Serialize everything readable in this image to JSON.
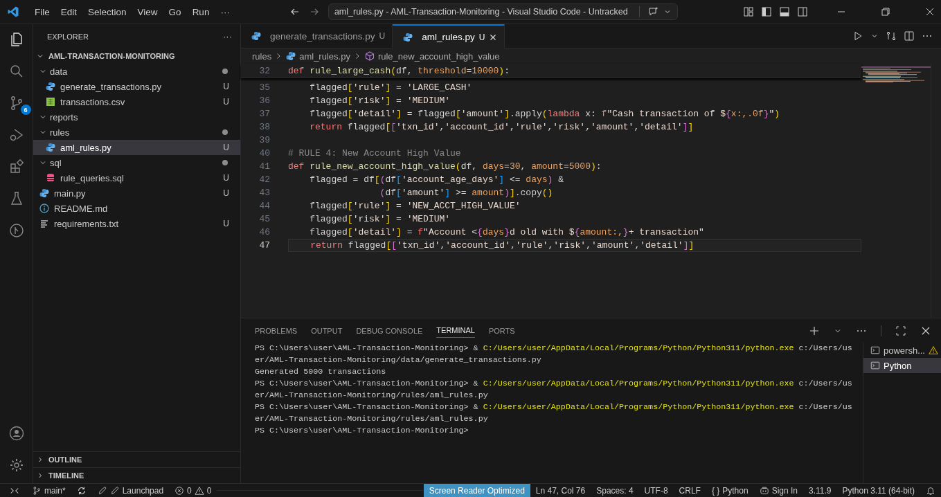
{
  "menu": [
    "File",
    "Edit",
    "Selection",
    "View",
    "Go",
    "Run",
    "···"
  ],
  "command_center": "aml_rules.py - AML-Transaction-Monitoring - Visual Studio Code - Untracked",
  "activity_badge": "6",
  "explorer": {
    "title": "EXPLORER",
    "more": "···",
    "root": {
      "label": "AML-TRANSACTION-MONITORING",
      "expanded": true,
      "children": [
        {
          "label": "data",
          "kind": "folder",
          "expanded": true,
          "dot": true,
          "selected": false,
          "children": [
            {
              "label": "generate_transactions.py",
              "kind": "python",
              "badge": "U",
              "selected": false
            },
            {
              "label": "transactions.csv",
              "kind": "csv",
              "badge": "U",
              "selected": false
            }
          ]
        },
        {
          "label": "reports",
          "kind": "folder",
          "expanded": true,
          "dot": false,
          "selected": false
        },
        {
          "label": "rules",
          "kind": "folder",
          "expanded": true,
          "dot": true,
          "selected": false,
          "children": [
            {
              "label": "aml_rules.py",
              "kind": "python",
              "badge": "U",
              "selected": true
            }
          ]
        },
        {
          "label": "sql",
          "kind": "folder",
          "expanded": true,
          "dot": true,
          "selected": false,
          "children": [
            {
              "label": "rule_queries.sql",
              "kind": "sql",
              "badge": "U",
              "selected": false
            }
          ]
        },
        {
          "label": "main.py",
          "kind": "python",
          "badge": "U",
          "selected": false
        },
        {
          "label": "README.md",
          "kind": "info",
          "selected": false
        },
        {
          "label": "requirements.txt",
          "kind": "text",
          "badge": "U",
          "selected": false
        }
      ]
    },
    "sections": [
      {
        "label": "OUTLINE",
        "expanded": false
      },
      {
        "label": "TIMELINE",
        "expanded": false
      }
    ]
  },
  "tabs": [
    {
      "label": "generate_transactions.py",
      "badge": "U",
      "selected": false
    },
    {
      "label": "aml_rules.py",
      "badge": "U",
      "selected": true
    }
  ],
  "breadcrumb": [
    "rules",
    "aml_rules.py",
    "rule_new_account_high_value"
  ],
  "sticky_line": {
    "num": "32",
    "tokens": [
      {
        "text": "def",
        "kind": "k"
      },
      {
        "text": " rule_large_cash",
        "kind": "f"
      },
      {
        "text": "(",
        "kind": "b1"
      },
      {
        "text": "df, ",
        "kind": "v"
      },
      {
        "text": "threshold",
        "kind": "p"
      },
      {
        "text": "=",
        "kind": "v"
      },
      {
        "text": "10000",
        "kind": "n"
      },
      {
        "text": ")",
        "kind": "b1"
      },
      {
        "text": ":",
        "kind": "v"
      }
    ]
  },
  "code": [
    {
      "num": "35",
      "current": false,
      "tokens": [
        {
          "text": "    flagged",
          "kind": "v"
        },
        {
          "text": "[",
          "kind": "b1"
        },
        {
          "text": "'rule'",
          "kind": "s"
        },
        {
          "text": "]",
          "kind": "b1"
        },
        {
          "text": " = ",
          "kind": "v"
        },
        {
          "text": "'LARGE_CASH'",
          "kind": "s"
        }
      ]
    },
    {
      "num": "36",
      "current": false,
      "tokens": [
        {
          "text": "    flagged",
          "kind": "v"
        },
        {
          "text": "[",
          "kind": "b1"
        },
        {
          "text": "'risk'",
          "kind": "s"
        },
        {
          "text": "]",
          "kind": "b1"
        },
        {
          "text": " = ",
          "kind": "v"
        },
        {
          "text": "'MEDIUM'",
          "kind": "s"
        }
      ]
    },
    {
      "num": "37",
      "current": false,
      "tokens": [
        {
          "text": "    flagged",
          "kind": "v"
        },
        {
          "text": "[",
          "kind": "b1"
        },
        {
          "text": "'detail'",
          "kind": "s"
        },
        {
          "text": "]",
          "kind": "b1"
        },
        {
          "text": " = flagged",
          "kind": "v"
        },
        {
          "text": "[",
          "kind": "b1"
        },
        {
          "text": "'amount'",
          "kind": "s"
        },
        {
          "text": "]",
          "kind": "b1"
        },
        {
          "text": ".apply",
          "kind": "v"
        },
        {
          "text": "(",
          "kind": "b1"
        },
        {
          "text": "lambda",
          "kind": "k"
        },
        {
          "text": " x: ",
          "kind": "v"
        },
        {
          "text": "f",
          "kind": "k"
        },
        {
          "text": "\"Cash transaction of $",
          "kind": "s"
        },
        {
          "text": "{",
          "kind": "b2"
        },
        {
          "text": "x:,.0f",
          "kind": "p"
        },
        {
          "text": "}",
          "kind": "b2"
        },
        {
          "text": "\"",
          "kind": "s"
        },
        {
          "text": ")",
          "kind": "b1"
        }
      ]
    },
    {
      "num": "38",
      "current": false,
      "tokens": [
        {
          "text": "    return",
          "kind": "k"
        },
        {
          "text": " flagged",
          "kind": "v"
        },
        {
          "text": "[",
          "kind": "b1"
        },
        {
          "text": "[",
          "kind": "b2"
        },
        {
          "text": "'txn_id'",
          "kind": "s"
        },
        {
          "text": ",",
          "kind": "v"
        },
        {
          "text": "'account_id'",
          "kind": "s"
        },
        {
          "text": ",",
          "kind": "v"
        },
        {
          "text": "'rule'",
          "kind": "s"
        },
        {
          "text": ",",
          "kind": "v"
        },
        {
          "text": "'risk'",
          "kind": "s"
        },
        {
          "text": ",",
          "kind": "v"
        },
        {
          "text": "'amount'",
          "kind": "s"
        },
        {
          "text": ",",
          "kind": "v"
        },
        {
          "text": "'detail'",
          "kind": "s"
        },
        {
          "text": "]",
          "kind": "b2"
        },
        {
          "text": "]",
          "kind": "b1"
        }
      ]
    },
    {
      "num": "39",
      "current": false
    },
    {
      "num": "40",
      "current": false,
      "tokens": [
        {
          "text": "# RULE 4: New Account High Value",
          "kind": "c"
        }
      ]
    },
    {
      "num": "41",
      "current": false,
      "tokens": [
        {
          "text": "def",
          "kind": "k"
        },
        {
          "text": " rule_new_account_high_value",
          "kind": "f"
        },
        {
          "text": "(",
          "kind": "b1"
        },
        {
          "text": "df, ",
          "kind": "v"
        },
        {
          "text": "days",
          "kind": "p"
        },
        {
          "text": "=",
          "kind": "v"
        },
        {
          "text": "30",
          "kind": "n"
        },
        {
          "text": ", ",
          "kind": "v"
        },
        {
          "text": "amount",
          "kind": "p"
        },
        {
          "text": "=",
          "kind": "v"
        },
        {
          "text": "5000",
          "kind": "n"
        },
        {
          "text": ")",
          "kind": "b1"
        },
        {
          "text": ":",
          "kind": "v"
        }
      ]
    },
    {
      "num": "42",
      "current": false,
      "tokens": [
        {
          "text": "    flagged = df",
          "kind": "v"
        },
        {
          "text": "[",
          "kind": "b1"
        },
        {
          "text": "(",
          "kind": "b2"
        },
        {
          "text": "df",
          "kind": "v"
        },
        {
          "text": "[",
          "kind": "b3"
        },
        {
          "text": "'account_age_days'",
          "kind": "s"
        },
        {
          "text": "]",
          "kind": "b3"
        },
        {
          "text": " <= ",
          "kind": "v"
        },
        {
          "text": "days",
          "kind": "p"
        },
        {
          "text": ")",
          "kind": "b2"
        },
        {
          "text": " &",
          "kind": "v"
        }
      ]
    },
    {
      "num": "43",
      "current": false,
      "tokens": [
        {
          "text": "                 (",
          "kind": "b2"
        },
        {
          "text": "df",
          "kind": "v"
        },
        {
          "text": "[",
          "kind": "b3"
        },
        {
          "text": "'amount'",
          "kind": "s"
        },
        {
          "text": "]",
          "kind": "b3"
        },
        {
          "text": " >= ",
          "kind": "v"
        },
        {
          "text": "amount",
          "kind": "p"
        },
        {
          "text": ")",
          "kind": "b2"
        },
        {
          "text": "]",
          "kind": "b1"
        },
        {
          "text": ".copy",
          "kind": "v"
        },
        {
          "text": "(",
          "kind": "b1"
        },
        {
          "text": ")",
          "kind": "b1"
        }
      ]
    },
    {
      "num": "44",
      "current": false,
      "tokens": [
        {
          "text": "    flagged",
          "kind": "v"
        },
        {
          "text": "[",
          "kind": "b1"
        },
        {
          "text": "'rule'",
          "kind": "s"
        },
        {
          "text": "]",
          "kind": "b1"
        },
        {
          "text": " = ",
          "kind": "v"
        },
        {
          "text": "'NEW_ACCT_HIGH_VALUE'",
          "kind": "s"
        }
      ]
    },
    {
      "num": "45",
      "current": false,
      "tokens": [
        {
          "text": "    flagged",
          "kind": "v"
        },
        {
          "text": "[",
          "kind": "b1"
        },
        {
          "text": "'risk'",
          "kind": "s"
        },
        {
          "text": "]",
          "kind": "b1"
        },
        {
          "text": " = ",
          "kind": "v"
        },
        {
          "text": "'MEDIUM'",
          "kind": "s"
        }
      ]
    },
    {
      "num": "46",
      "current": false,
      "tokens": [
        {
          "text": "    flagged",
          "kind": "v"
        },
        {
          "text": "[",
          "kind": "b1"
        },
        {
          "text": "'detail'",
          "kind": "s"
        },
        {
          "text": "]",
          "kind": "b1"
        },
        {
          "text": " = ",
          "kind": "v"
        },
        {
          "text": "f",
          "kind": "k"
        },
        {
          "text": "\"Account <",
          "kind": "s"
        },
        {
          "text": "{",
          "kind": "b2"
        },
        {
          "text": "days",
          "kind": "p"
        },
        {
          "text": "}",
          "kind": "b2"
        },
        {
          "text": "d old with $",
          "kind": "s"
        },
        {
          "text": "{",
          "kind": "b2"
        },
        {
          "text": "amount:,",
          "kind": "p"
        },
        {
          "text": "}",
          "kind": "b2"
        },
        {
          "text": "+ transaction\"",
          "kind": "s"
        }
      ]
    },
    {
      "num": "47",
      "current": true,
      "tokens": [
        {
          "text": "    return",
          "kind": "k"
        },
        {
          "text": " flagged",
          "kind": "v"
        },
        {
          "text": "[",
          "kind": "b1"
        },
        {
          "text": "[",
          "kind": "b2"
        },
        {
          "text": "'txn_id'",
          "kind": "s"
        },
        {
          "text": ",",
          "kind": "v"
        },
        {
          "text": "'account_id'",
          "kind": "s"
        },
        {
          "text": ",",
          "kind": "v"
        },
        {
          "text": "'rule'",
          "kind": "s"
        },
        {
          "text": ",",
          "kind": "v"
        },
        {
          "text": "'risk'",
          "kind": "s"
        },
        {
          "text": ",",
          "kind": "v"
        },
        {
          "text": "'amount'",
          "kind": "s"
        },
        {
          "text": ",",
          "kind": "v"
        },
        {
          "text": "'detail'",
          "kind": "s"
        },
        {
          "text": "]",
          "kind": "b2"
        },
        {
          "text": "]",
          "kind": "b1"
        }
      ]
    }
  ],
  "panel_tabs": [
    {
      "label": "PROBLEMS",
      "selected": false
    },
    {
      "label": "OUTPUT",
      "selected": false
    },
    {
      "label": "DEBUG CONSOLE",
      "selected": false
    },
    {
      "label": "TERMINAL",
      "selected": true
    },
    {
      "label": "PORTS",
      "selected": false
    }
  ],
  "terminal": [
    [
      {
        "text": "PS C:\\Users\\user\\AML-Transaction-Monitoring> & ",
        "kind": "t"
      },
      {
        "text": "C:/Users/user/AppData/Local/Programs/Python/Python311/python.exe",
        "kind": "y"
      },
      {
        "text": " c:/Users/us",
        "kind": "t"
      }
    ],
    [
      {
        "text": "er/AML-Transaction-Monitoring/data/generate_transactions.py",
        "kind": "t"
      }
    ],
    [
      {
        "text": "Generated 5000 transactions",
        "kind": "t"
      }
    ],
    [
      {
        "text": "PS C:\\Users\\user\\AML-Transaction-Monitoring> & ",
        "kind": "t"
      },
      {
        "text": "C:/Users/user/AppData/Local/Programs/Python/Python311/python.exe",
        "kind": "y"
      },
      {
        "text": " c:/Users/us",
        "kind": "t"
      }
    ],
    [
      {
        "text": "er/AML-Transaction-Monitoring/rules/aml_rules.py",
        "kind": "t"
      }
    ],
    [
      {
        "text": "PS C:\\Users\\user\\AML-Transaction-Monitoring> & ",
        "kind": "t"
      },
      {
        "text": "C:/Users/user/AppData/Local/Programs/Python/Python311/python.exe",
        "kind": "y"
      },
      {
        "text": " c:/Users/us",
        "kind": "t"
      }
    ],
    [
      {
        "text": "er/AML-Transaction-Monitoring/rules/aml_rules.py",
        "kind": "t"
      }
    ],
    [
      {
        "text": "PS C:\\Users\\user\\AML-Transaction-Monitoring>",
        "kind": "t"
      }
    ]
  ],
  "terminals": [
    {
      "label": "powersh...",
      "warning": true,
      "selected": false
    },
    {
      "label": "Python",
      "warning": false,
      "selected": true
    }
  ],
  "status": {
    "branch": "main*",
    "launchpad": "Launchpad",
    "errors": "0",
    "warnings": "0",
    "screen_reader": "Screen Reader Optimized",
    "position": "Ln 47, Col 76",
    "indent": "Spaces: 4",
    "encoding": "UTF-8",
    "eol": "CRLF",
    "braces": "{ }",
    "language": "Python",
    "sign_in": "Sign In",
    "python_version": "3.11.9",
    "interpreter": "Python 3.11 (64-bit)"
  }
}
